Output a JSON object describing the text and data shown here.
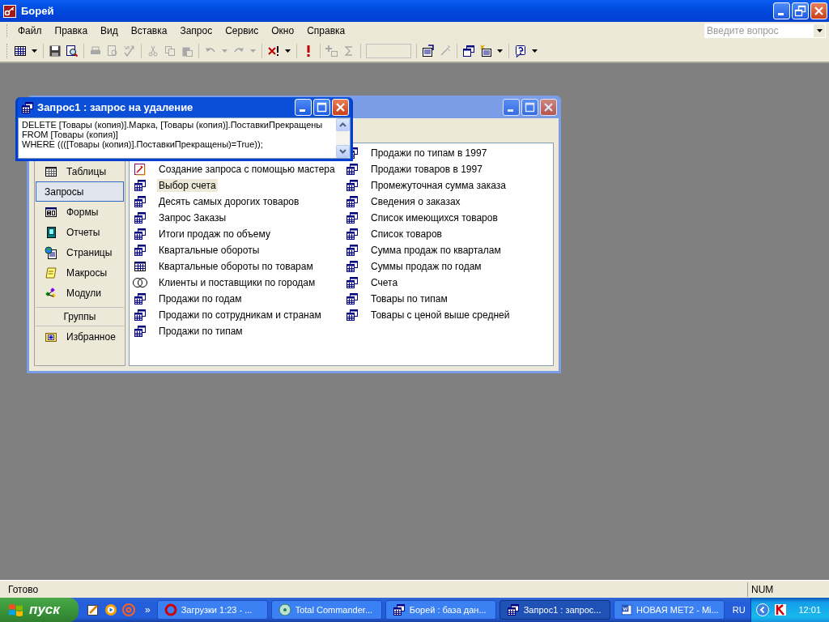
{
  "app": {
    "title": "Борей"
  },
  "menu": [
    {
      "label": "Файл"
    },
    {
      "label": "Правка"
    },
    {
      "label": "Вид"
    },
    {
      "label": "Вставка"
    },
    {
      "label": "Запрос"
    },
    {
      "label": "Сервис"
    },
    {
      "label": "Окно"
    },
    {
      "label": "Справка"
    }
  ],
  "help_box": {
    "placeholder": "Введите вопрос"
  },
  "query_window": {
    "title": "Запрос1 : запрос на удаление",
    "sql": [
      "DELETE [Товары (копия)].Марка, [Товары (копия)].ПоставкиПрекращены",
      "FROM [Товары (копия)]",
      "WHERE ((([Товары (копия)].ПоставкиПрекращены)=True));"
    ]
  },
  "database_window": {
    "objects": [
      {
        "label": "Таблицы",
        "kind": "tables",
        "selected": false
      },
      {
        "label": "Запросы",
        "kind": "queries",
        "selected": true
      },
      {
        "label": "Формы",
        "kind": "forms",
        "selected": false
      },
      {
        "label": "Отчеты",
        "kind": "reports",
        "selected": false
      },
      {
        "label": "Страницы",
        "kind": "pages",
        "selected": false
      },
      {
        "label": "Макросы",
        "kind": "macros",
        "selected": false
      },
      {
        "label": "Модули",
        "kind": "modules",
        "selected": false
      }
    ],
    "groups_header": "Группы",
    "groups": [
      {
        "label": "Избранное",
        "kind": "favorites",
        "selected": false
      }
    ],
    "items": [
      {
        "label": "Создание запроса с помощью мастера",
        "kind": "wizard",
        "selected": false
      },
      {
        "label": "Выбор счета",
        "kind": "select",
        "selected": true
      },
      {
        "label": "Десять самых дорогих товаров",
        "kind": "select",
        "selected": false
      },
      {
        "label": "Запрос Заказы",
        "kind": "select",
        "selected": false
      },
      {
        "label": "Итоги продаж по объему",
        "kind": "select",
        "selected": false
      },
      {
        "label": "Квартальные обороты",
        "kind": "select",
        "selected": false
      },
      {
        "label": "Квартальные обороты по товарам",
        "kind": "crosstab",
        "selected": false
      },
      {
        "label": "Клиенты и поставщики по городам",
        "kind": "union",
        "selected": false
      },
      {
        "label": "Продажи по годам",
        "kind": "select",
        "selected": false
      },
      {
        "label": "Продажи по сотрудникам и странам",
        "kind": "select",
        "selected": false
      },
      {
        "label": "Продажи по типам",
        "kind": "select",
        "selected": false
      },
      {
        "label": "Продажи по типам в 1997",
        "kind": "select",
        "selected": false
      },
      {
        "label": "Продажи товаров в 1997",
        "kind": "select",
        "selected": false
      },
      {
        "label": "Промежуточная сумма заказа",
        "kind": "select",
        "selected": false
      },
      {
        "label": "Сведения о заказах",
        "kind": "select",
        "selected": false
      },
      {
        "label": "Список имеющихся товаров",
        "kind": "select",
        "selected": false
      },
      {
        "label": "Список товаров",
        "kind": "select",
        "selected": false
      },
      {
        "label": "Сумма продаж по кварталам",
        "kind": "select",
        "selected": false
      },
      {
        "label": "Суммы продаж по годам",
        "kind": "select",
        "selected": false
      },
      {
        "label": "Счета",
        "kind": "select",
        "selected": false
      },
      {
        "label": "Товары по типам",
        "kind": "select",
        "selected": false
      },
      {
        "label": "Товары с ценой выше средней",
        "kind": "select",
        "selected": false
      }
    ]
  },
  "status_bar": {
    "text": "Готово",
    "indicator": "NUM"
  },
  "taskbar": {
    "start": "пуск",
    "more": "»",
    "tasks": [
      {
        "label": "Загрузки 1:23 - ...",
        "kind": "download",
        "selected": false
      },
      {
        "label": "Total Commander...",
        "kind": "commander",
        "selected": false
      },
      {
        "label": "Борей : база дан...",
        "kind": "database",
        "selected": false
      },
      {
        "label": "Запрос1 : запрос...",
        "kind": "query",
        "selected": true
      },
      {
        "label": "НОВАЯ МЕТ2 - Mi...",
        "kind": "document",
        "selected": false
      }
    ],
    "language": "RU",
    "clock": "12:01"
  }
}
